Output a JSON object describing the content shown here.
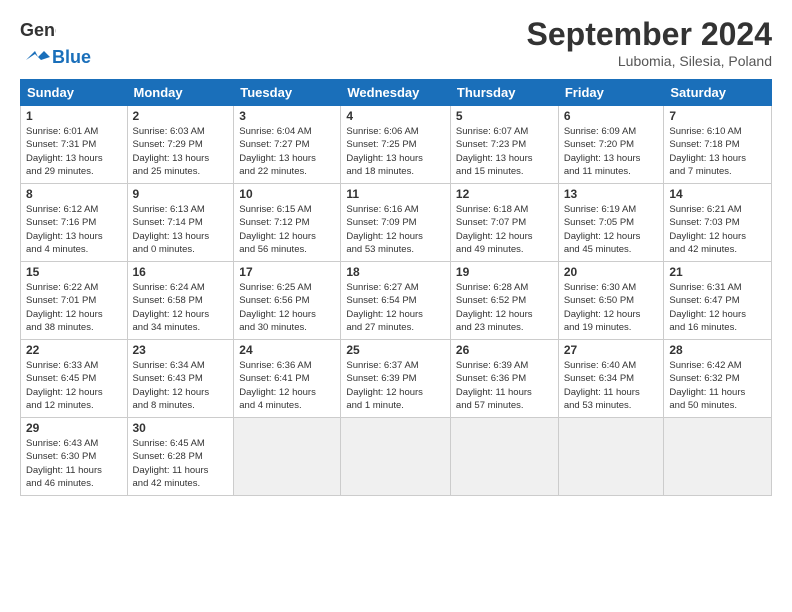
{
  "header": {
    "logo_text_general": "General",
    "logo_text_blue": "Blue",
    "month": "September 2024",
    "location": "Lubomia, Silesia, Poland"
  },
  "weekdays": [
    "Sunday",
    "Monday",
    "Tuesday",
    "Wednesday",
    "Thursday",
    "Friday",
    "Saturday"
  ],
  "days": [
    {
      "num": "",
      "info": "",
      "empty": true
    },
    {
      "num": "1",
      "info": "Sunrise: 6:01 AM\nSunset: 7:31 PM\nDaylight: 13 hours\nand 29 minutes."
    },
    {
      "num": "2",
      "info": "Sunrise: 6:03 AM\nSunset: 7:29 PM\nDaylight: 13 hours\nand 25 minutes."
    },
    {
      "num": "3",
      "info": "Sunrise: 6:04 AM\nSunset: 7:27 PM\nDaylight: 13 hours\nand 22 minutes."
    },
    {
      "num": "4",
      "info": "Sunrise: 6:06 AM\nSunset: 7:25 PM\nDaylight: 13 hours\nand 18 minutes."
    },
    {
      "num": "5",
      "info": "Sunrise: 6:07 AM\nSunset: 7:23 PM\nDaylight: 13 hours\nand 15 minutes."
    },
    {
      "num": "6",
      "info": "Sunrise: 6:09 AM\nSunset: 7:20 PM\nDaylight: 13 hours\nand 11 minutes."
    },
    {
      "num": "7",
      "info": "Sunrise: 6:10 AM\nSunset: 7:18 PM\nDaylight: 13 hours\nand 7 minutes."
    },
    {
      "num": "8",
      "info": "Sunrise: 6:12 AM\nSunset: 7:16 PM\nDaylight: 13 hours\nand 4 minutes."
    },
    {
      "num": "9",
      "info": "Sunrise: 6:13 AM\nSunset: 7:14 PM\nDaylight: 13 hours\nand 0 minutes."
    },
    {
      "num": "10",
      "info": "Sunrise: 6:15 AM\nSunset: 7:12 PM\nDaylight: 12 hours\nand 56 minutes."
    },
    {
      "num": "11",
      "info": "Sunrise: 6:16 AM\nSunset: 7:09 PM\nDaylight: 12 hours\nand 53 minutes."
    },
    {
      "num": "12",
      "info": "Sunrise: 6:18 AM\nSunset: 7:07 PM\nDaylight: 12 hours\nand 49 minutes."
    },
    {
      "num": "13",
      "info": "Sunrise: 6:19 AM\nSunset: 7:05 PM\nDaylight: 12 hours\nand 45 minutes."
    },
    {
      "num": "14",
      "info": "Sunrise: 6:21 AM\nSunset: 7:03 PM\nDaylight: 12 hours\nand 42 minutes."
    },
    {
      "num": "15",
      "info": "Sunrise: 6:22 AM\nSunset: 7:01 PM\nDaylight: 12 hours\nand 38 minutes."
    },
    {
      "num": "16",
      "info": "Sunrise: 6:24 AM\nSunset: 6:58 PM\nDaylight: 12 hours\nand 34 minutes."
    },
    {
      "num": "17",
      "info": "Sunrise: 6:25 AM\nSunset: 6:56 PM\nDaylight: 12 hours\nand 30 minutes."
    },
    {
      "num": "18",
      "info": "Sunrise: 6:27 AM\nSunset: 6:54 PM\nDaylight: 12 hours\nand 27 minutes."
    },
    {
      "num": "19",
      "info": "Sunrise: 6:28 AM\nSunset: 6:52 PM\nDaylight: 12 hours\nand 23 minutes."
    },
    {
      "num": "20",
      "info": "Sunrise: 6:30 AM\nSunset: 6:50 PM\nDaylight: 12 hours\nand 19 minutes."
    },
    {
      "num": "21",
      "info": "Sunrise: 6:31 AM\nSunset: 6:47 PM\nDaylight: 12 hours\nand 16 minutes."
    },
    {
      "num": "22",
      "info": "Sunrise: 6:33 AM\nSunset: 6:45 PM\nDaylight: 12 hours\nand 12 minutes."
    },
    {
      "num": "23",
      "info": "Sunrise: 6:34 AM\nSunset: 6:43 PM\nDaylight: 12 hours\nand 8 minutes."
    },
    {
      "num": "24",
      "info": "Sunrise: 6:36 AM\nSunset: 6:41 PM\nDaylight: 12 hours\nand 4 minutes."
    },
    {
      "num": "25",
      "info": "Sunrise: 6:37 AM\nSunset: 6:39 PM\nDaylight: 12 hours\nand 1 minute."
    },
    {
      "num": "26",
      "info": "Sunrise: 6:39 AM\nSunset: 6:36 PM\nDaylight: 11 hours\nand 57 minutes."
    },
    {
      "num": "27",
      "info": "Sunrise: 6:40 AM\nSunset: 6:34 PM\nDaylight: 11 hours\nand 53 minutes."
    },
    {
      "num": "28",
      "info": "Sunrise: 6:42 AM\nSunset: 6:32 PM\nDaylight: 11 hours\nand 50 minutes."
    },
    {
      "num": "29",
      "info": "Sunrise: 6:43 AM\nSunset: 6:30 PM\nDaylight: 11 hours\nand 46 minutes."
    },
    {
      "num": "30",
      "info": "Sunrise: 6:45 AM\nSunset: 6:28 PM\nDaylight: 11 hours\nand 42 minutes."
    },
    {
      "num": "",
      "info": "",
      "empty": true
    },
    {
      "num": "",
      "info": "",
      "empty": true
    },
    {
      "num": "",
      "info": "",
      "empty": true
    },
    {
      "num": "",
      "info": "",
      "empty": true
    },
    {
      "num": "",
      "info": "",
      "empty": true
    }
  ]
}
